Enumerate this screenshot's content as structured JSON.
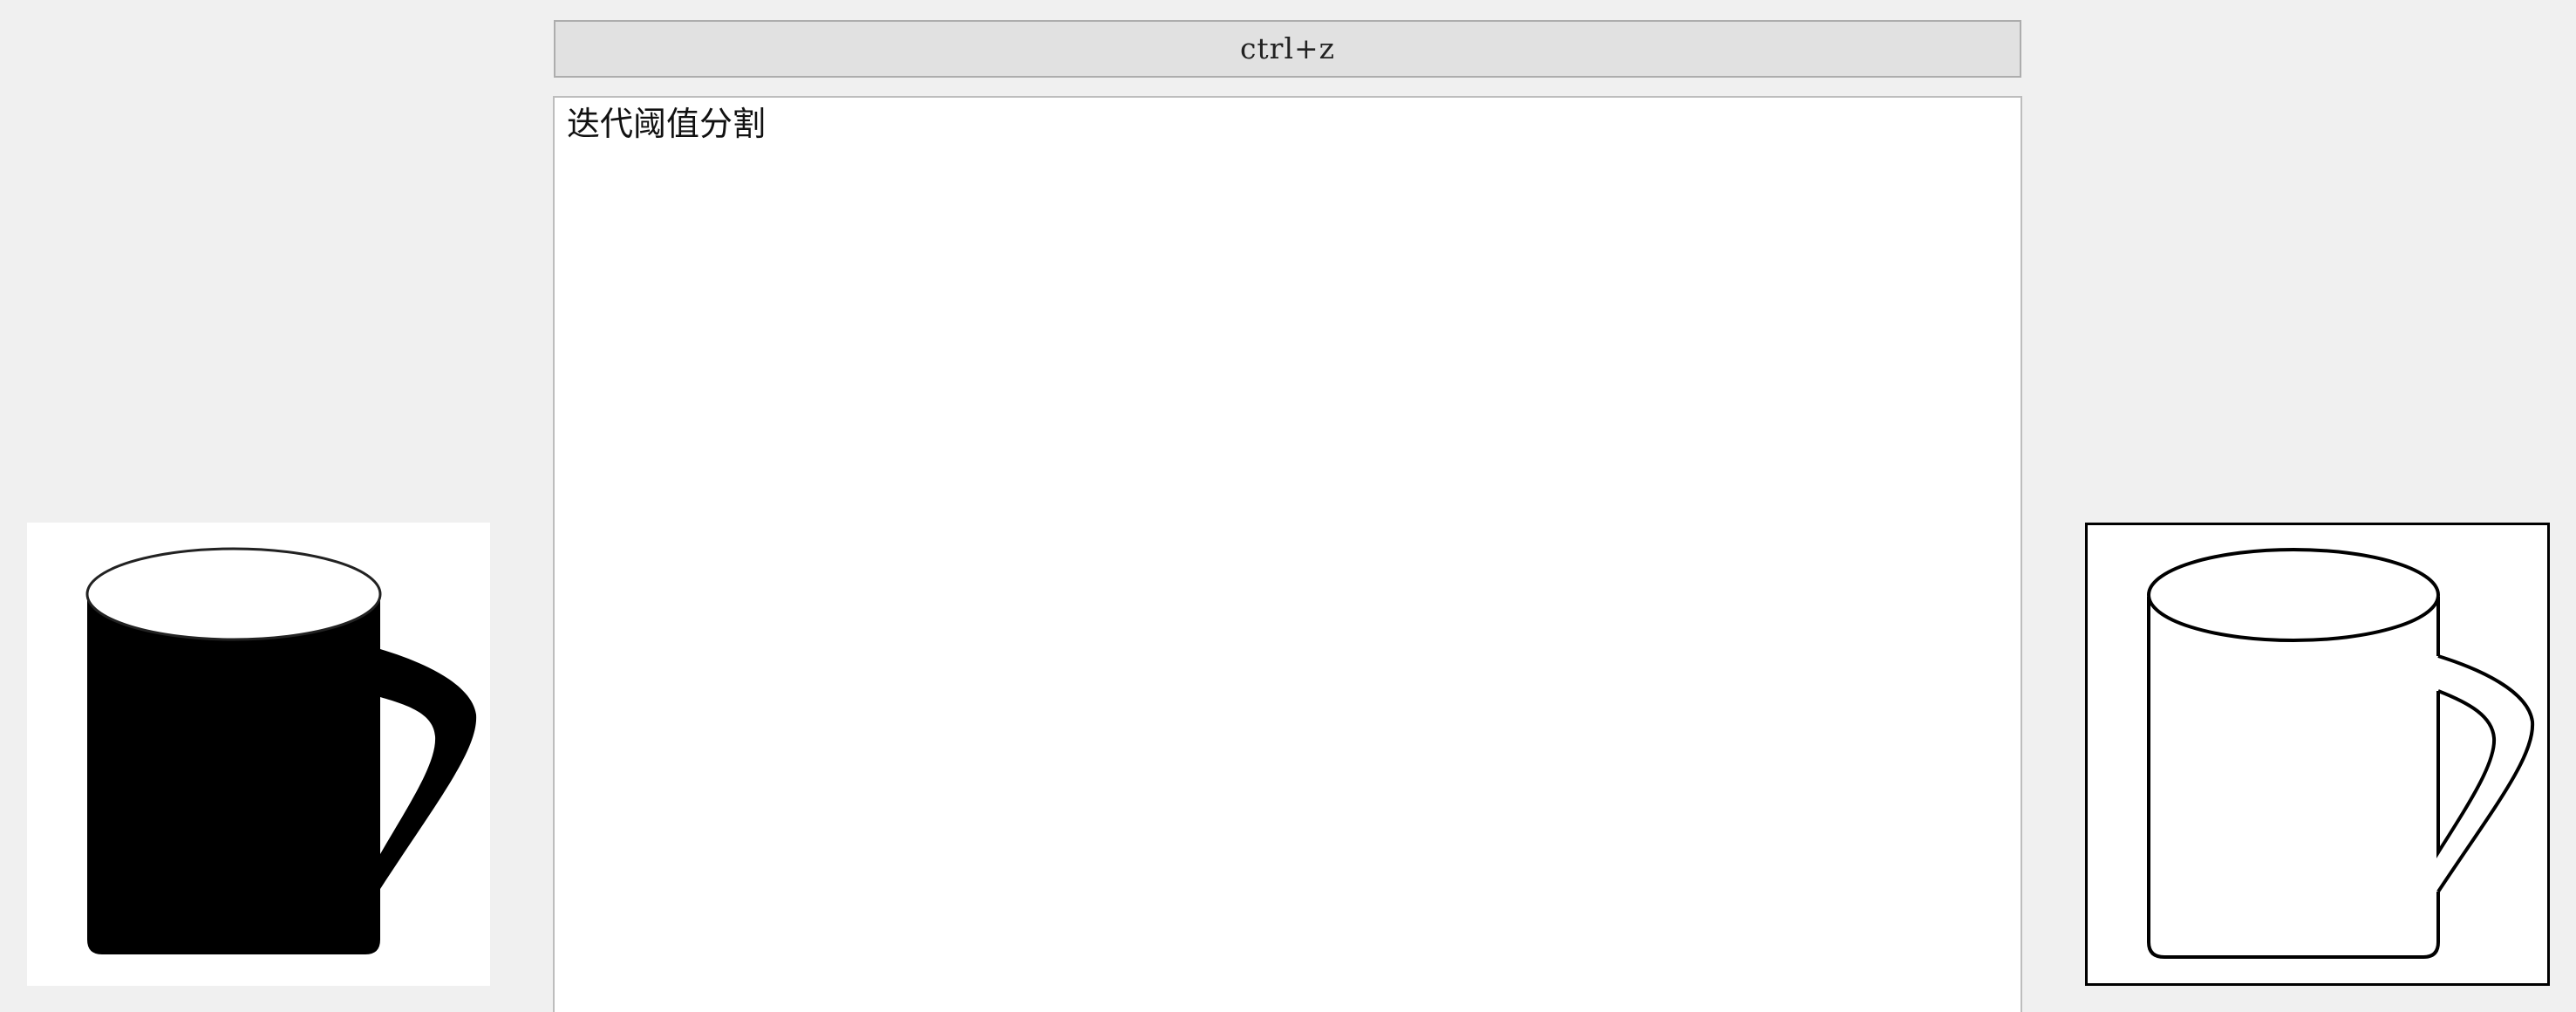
{
  "toolbar": {
    "undo_label": "ctrl+z"
  },
  "log": {
    "text": "迭代阈值分割"
  },
  "images": {
    "original": {
      "icon": "mug-binary-image"
    },
    "result": {
      "icon": "mug-edge-image"
    }
  }
}
